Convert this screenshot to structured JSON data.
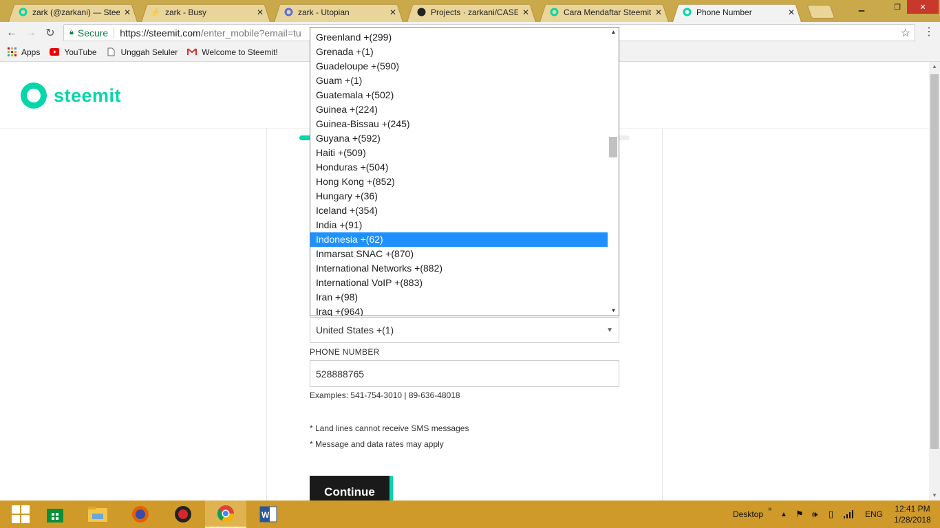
{
  "browser": {
    "tabs": [
      {
        "title": "zark (@zarkani) — Steem",
        "icon": "steemit-icon"
      },
      {
        "title": "zark - Busy",
        "icon": "busy-icon"
      },
      {
        "title": "zark - Utopian",
        "icon": "utopian-icon"
      },
      {
        "title": "Projects · zarkani/CASE",
        "icon": "github-icon"
      },
      {
        "title": "Cara Mendaftar Steemit -",
        "icon": "steemit-icon"
      },
      {
        "title": "Phone Number",
        "icon": "steemit-icon"
      }
    ],
    "active_tab": 5,
    "security_label": "Secure",
    "url_host": "https://steemit.com",
    "url_path": "/enter_mobile?email=tu",
    "bookmarks": [
      {
        "label": "Apps",
        "icon": "apps-grid-icon"
      },
      {
        "label": "YouTube",
        "icon": "youtube-icon"
      },
      {
        "label": "Unggah Seluler",
        "icon": "page-icon"
      },
      {
        "label": "Welcome to Steemit!",
        "icon": "gmail-icon"
      }
    ]
  },
  "page": {
    "logo_text": "steemit",
    "progress_fraction": 0.04,
    "selected_country": "United States +(1)",
    "phone_label": "PHONE NUMBER",
    "phone_value": "528888765",
    "examples": "Examples: 541-754-3010 | 89-636-48018",
    "note1": "* Land lines cannot receive SMS messages",
    "note2": "* Message and data rates may apply",
    "continue_label": "Continue"
  },
  "dropdown": {
    "items": [
      "Greenland +(299)",
      "Grenada +(1)",
      "Guadeloupe +(590)",
      "Guam +(1)",
      "Guatemala +(502)",
      "Guinea +(224)",
      "Guinea-Bissau +(245)",
      "Guyana +(592)",
      "Haiti +(509)",
      "Honduras +(504)",
      "Hong Kong +(852)",
      "Hungary +(36)",
      "Iceland +(354)",
      "India +(91)",
      "Indonesia +(62)",
      "Inmarsat SNAC +(870)",
      "International Networks +(882)",
      "International VoIP +(883)",
      "Iran +(98)",
      "Iraq +(964)"
    ],
    "highlighted": "Indonesia +(62)"
  },
  "taskbar": {
    "desktop_label": "Desktop",
    "language": "ENG",
    "time": "12:41 PM",
    "date": "1/28/2018"
  },
  "colors": {
    "accent": "#06d6a9",
    "selection": "#1e90ff",
    "taskbar": "#cf9a2a"
  }
}
